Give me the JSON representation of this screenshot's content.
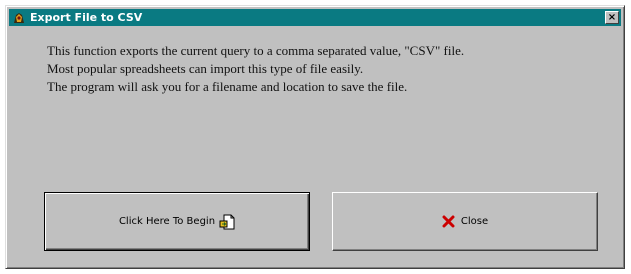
{
  "window": {
    "title": "Export File to CSV",
    "title_icon": "app-icon",
    "close_glyph": "×",
    "titlebar_color": "#0a7a82",
    "background_color": "#c0c0c0"
  },
  "message": {
    "lines": [
      "This function exports the current query to a comma separated value, \"CSV\" file.",
      "Most popular spreadsheets can import this type of file easily.",
      "The program will ask you for a filename and location to save the file."
    ]
  },
  "buttons": {
    "begin": {
      "label": "Click Here To Begin",
      "icon": "export-file-icon"
    },
    "close": {
      "label": "Close",
      "icon": "red-x-icon",
      "icon_color": "#cc0000"
    }
  }
}
